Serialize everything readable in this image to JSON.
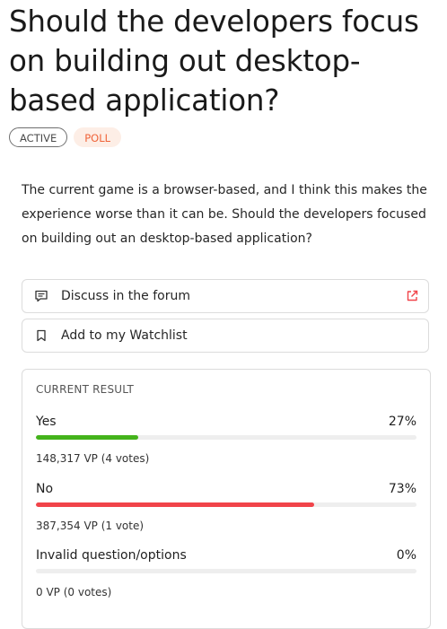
{
  "proposal": {
    "title": "Should the developers focus on building out desktop-based application?",
    "badges": {
      "status": "ACTIVE",
      "type": "POLL"
    },
    "description": "The current game is a browser-based, and I think this makes the experience worse than it can be. Should the developers focused on building out an desktop-based application?"
  },
  "links": {
    "forum": {
      "label": "Discuss in the forum",
      "icon": "chat-bubble-icon",
      "external_icon": "external-link-icon"
    },
    "watchlist": {
      "label": "Add to my Watchlist",
      "icon": "bookmark-icon"
    }
  },
  "results": {
    "title": "CURRENT RESULT",
    "options": [
      {
        "label": "Yes",
        "percent_label": "27%",
        "fraction": 0.27,
        "votes": "148,317 VP (4 votes)",
        "color": "#44b31b"
      },
      {
        "label": "No",
        "percent_label": "73%",
        "fraction": 0.73,
        "votes": "387,354 VP (1 vote)",
        "color": "#f1444a"
      },
      {
        "label": "Invalid question/options",
        "percent_label": "0%",
        "fraction": 0,
        "votes": "0 VP (0 votes)",
        "color": "#999999"
      }
    ]
  },
  "colors": {
    "poll_badge_text": "#f0643a",
    "poll_badge_bg": "#fdeee6",
    "external_link": "#f1444a"
  }
}
